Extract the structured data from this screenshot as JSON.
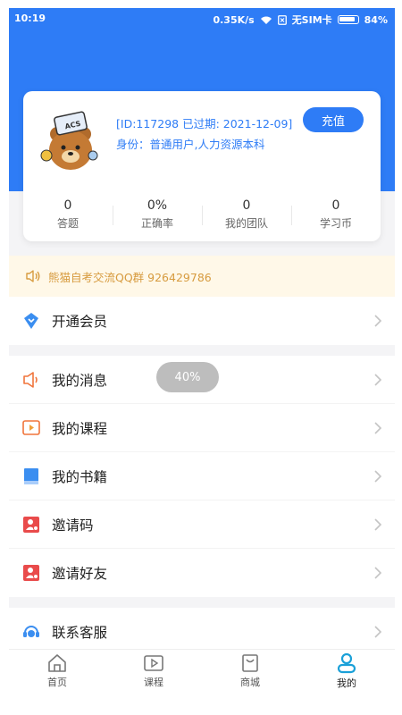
{
  "status_bar": {
    "time": "10:19",
    "network_speed": "0.35K/s",
    "sim": "无SIM卡",
    "battery": "84%"
  },
  "profile": {
    "id_line": "[ID:117298 已过期: 2021-12-09]",
    "role_line": "身份：普通用户,人力资源本科",
    "recharge_label": "充值",
    "avatar_icon": "bear-avatar-icon"
  },
  "stats": [
    {
      "value": "0",
      "label": "答题"
    },
    {
      "value": "0%",
      "label": "正确率"
    },
    {
      "value": "0",
      "label": "我的团队"
    },
    {
      "value": "0",
      "label": "学习币"
    }
  ],
  "notice": {
    "text": "熊猫自考交流QQ群 926429786",
    "icon": "speaker-icon"
  },
  "menu": {
    "group1": [
      {
        "label": "开通会员",
        "icon": "vip-diamond-icon",
        "color": "#3b8ef0"
      }
    ],
    "group2": [
      {
        "label": "我的消息",
        "icon": "message-speaker-icon",
        "color": "#f0753b"
      },
      {
        "label": "我的课程",
        "icon": "course-play-icon",
        "color": "#f0753b"
      },
      {
        "label": "我的书籍",
        "icon": "book-icon",
        "color": "#3b8ef0"
      },
      {
        "label": "邀请码",
        "icon": "invite-code-icon",
        "color": "#e94b4b"
      },
      {
        "label": "邀请好友",
        "icon": "invite-friend-icon",
        "color": "#e94b4b"
      }
    ],
    "group3": [
      {
        "label": "联系客服",
        "icon": "customer-service-icon",
        "color": "#3b8ef0"
      }
    ]
  },
  "toast": {
    "text": "40%"
  },
  "tabbar": [
    {
      "label": "首页",
      "icon": "home-icon",
      "active": false
    },
    {
      "label": "课程",
      "icon": "play-icon",
      "active": false
    },
    {
      "label": "商城",
      "icon": "shop-icon",
      "active": false
    },
    {
      "label": "我的",
      "icon": "user-icon",
      "active": true
    }
  ],
  "colors": {
    "brand_blue": "#2e7cf6",
    "active_tab": "#1aa0d8",
    "notice_text": "#d79b3f"
  }
}
